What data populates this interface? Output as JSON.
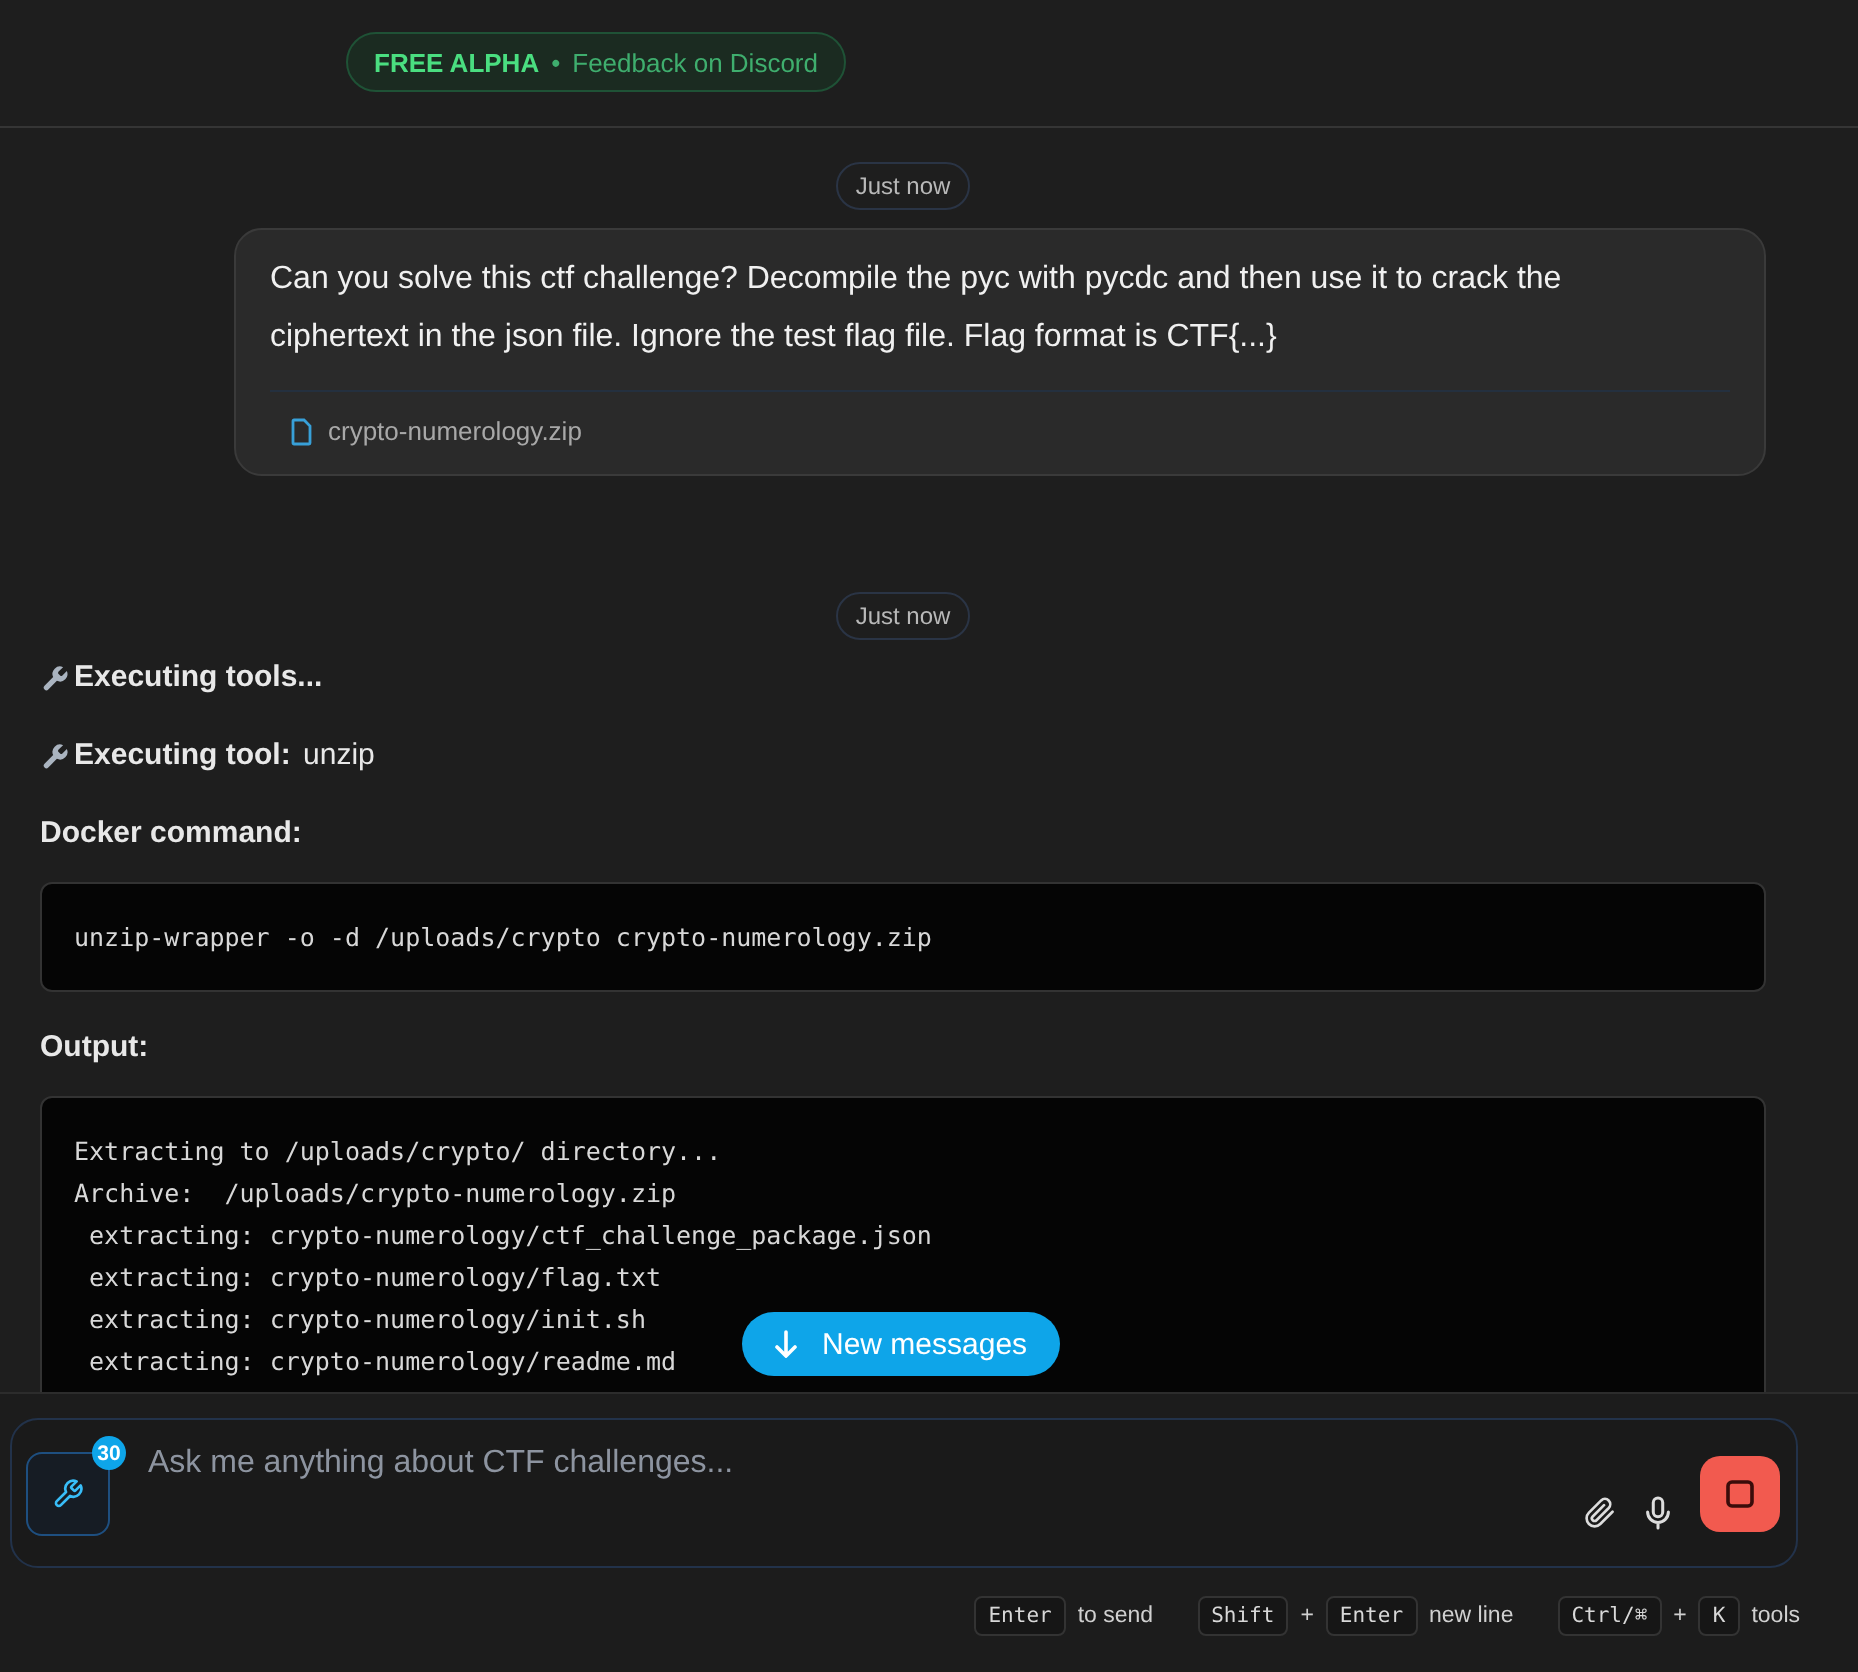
{
  "header": {
    "badge": {
      "label": "FREE ALPHA",
      "separator": "•",
      "link": "Feedback on Discord"
    }
  },
  "messages": [
    {
      "kind": "timestamp",
      "text": "Just now"
    },
    {
      "kind": "user",
      "text": "Can you solve this ctf challenge? Decompile the pyc with pycdc and then use it to crack the ciphertext in the json file. Ignore the test flag file. Flag format is CTF{...}",
      "attachment": "crypto-numerology.zip"
    },
    {
      "kind": "timestamp",
      "text": "Just now"
    },
    {
      "kind": "assistant",
      "blocks": [
        {
          "kind": "status",
          "label": "Executing tools..."
        },
        {
          "kind": "status",
          "label": "Executing tool:",
          "value": "unzip"
        },
        {
          "kind": "heading",
          "text": "Docker command:"
        },
        {
          "kind": "code",
          "lines": [
            "unzip-wrapper -o -d /uploads/crypto crypto-numerology.zip"
          ]
        },
        {
          "kind": "heading",
          "text": "Output:"
        },
        {
          "kind": "code",
          "lines": [
            "Extracting to /uploads/crypto/ directory...",
            "Archive:  /uploads/crypto-numerology.zip",
            " extracting: crypto-numerology/ctf_challenge_package.json",
            " extracting: crypto-numerology/flag.txt",
            " extracting: crypto-numerology/init.sh",
            " extracting: crypto-numerology/readme.md"
          ]
        }
      ]
    }
  ],
  "new_messages_button": {
    "label": "New messages"
  },
  "composer": {
    "tools_count": "30",
    "placeholder": "Ask me anything about CTF challenges...",
    "hints": [
      {
        "parts": [
          {
            "kind": "key",
            "text": "Enter"
          },
          {
            "kind": "label",
            "text": "to send"
          }
        ]
      },
      {
        "parts": [
          {
            "kind": "key",
            "text": "Shift"
          },
          {
            "kind": "plus",
            "text": "+"
          },
          {
            "kind": "key",
            "text": "Enter"
          },
          {
            "kind": "label",
            "text": "new line"
          }
        ]
      },
      {
        "parts": [
          {
            "kind": "key",
            "text": "Ctrl/⌘"
          },
          {
            "kind": "plus",
            "text": "+"
          },
          {
            "kind": "key",
            "text": "K"
          },
          {
            "kind": "label",
            "text": "tools"
          }
        ]
      }
    ]
  }
}
